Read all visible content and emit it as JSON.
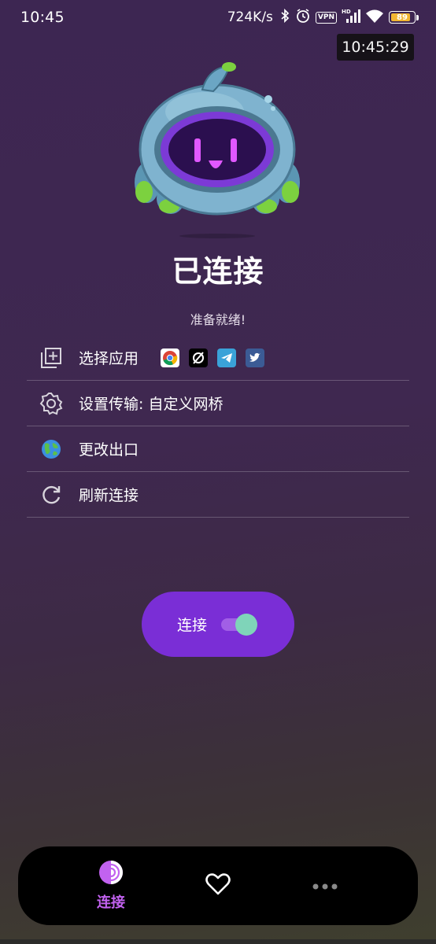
{
  "status_bar": {
    "time": "10:45",
    "net_speed": "724K/s",
    "vpn": "VPN",
    "hd": "HD",
    "battery": "89"
  },
  "clock_overlay": "10:45:29",
  "connection": {
    "title": "已连接",
    "subtitle": "准备就绪!"
  },
  "menu": {
    "items": [
      {
        "label": "选择应用",
        "icon": "app-add-icon"
      },
      {
        "label": "设置传输: 自定义网桥",
        "icon": "gear-icon"
      },
      {
        "label": "更改出口",
        "icon": "globe-icon"
      },
      {
        "label": "刷新连接",
        "icon": "refresh-icon"
      }
    ],
    "apps": [
      "chrome-icon",
      "cut-icon",
      "telegram-icon",
      "twitter-icon"
    ]
  },
  "connect_button": {
    "label": "连接",
    "toggle_on": true
  },
  "bottom_nav": {
    "items": [
      {
        "label": "连接",
        "icon": "tor-onion-icon",
        "active": true
      },
      {
        "label": "",
        "icon": "heart-icon",
        "active": false
      },
      {
        "label": "",
        "icon": "more-icon",
        "active": false
      }
    ]
  },
  "colors": {
    "accent": "#7a2ed6",
    "nav_active": "#c262f0",
    "toggle_thumb": "#7fd4b9",
    "battery": "#f2b632"
  }
}
